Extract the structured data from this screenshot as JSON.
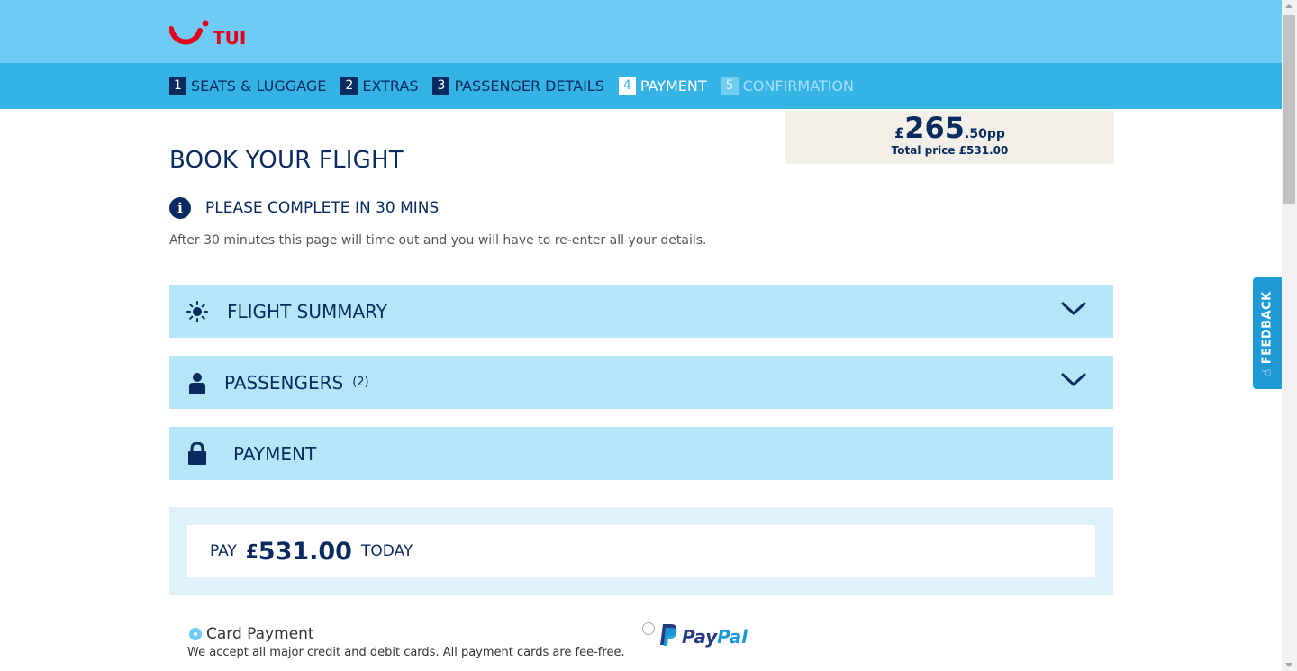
{
  "header": {
    "brand": "TUI",
    "brand_color": "#e2001a",
    "bg_color": "#70cbf4"
  },
  "steps": [
    {
      "num": "1",
      "label": "SEATS & LUGGAGE",
      "state": "done"
    },
    {
      "num": "2",
      "label": "EXTRAS",
      "state": "done"
    },
    {
      "num": "3",
      "label": "PASSENGER DETAILS",
      "state": "done"
    },
    {
      "num": "4",
      "label": "PAYMENT",
      "state": "current"
    },
    {
      "num": "5",
      "label": "CONFIRMATION",
      "state": "future"
    }
  ],
  "price": {
    "currency": "£",
    "whole": "265",
    "decimal": ".50pp",
    "total": "Total price £531.00"
  },
  "page": {
    "title": "BOOK YOUR FLIGHT",
    "timeout_title": "PLEASE COMPLETE IN 30 MINS",
    "timeout_text": "After 30 minutes this page will time out and you will have to re-enter all your details."
  },
  "sections": {
    "flight_summary": {
      "title": "FLIGHT SUMMARY",
      "icon": "sun-icon"
    },
    "passengers": {
      "title": "PASSENGERS",
      "count": "(2)",
      "icon": "person-icon"
    },
    "payment": {
      "title": "PAYMENT",
      "icon": "lock-icon"
    }
  },
  "pay": {
    "label": "PAY",
    "currency": "£",
    "amount": "531.00",
    "suffix": "TODAY"
  },
  "payment_options": {
    "card": {
      "label": "Card Payment",
      "description": "We accept all major credit and debit cards. All payment cards are fee-free.",
      "selected": true
    },
    "paypal": {
      "label_pay": "Pay",
      "label_pal": "Pal",
      "selected": false
    }
  },
  "feedback": {
    "label": "FEEDBACK"
  }
}
